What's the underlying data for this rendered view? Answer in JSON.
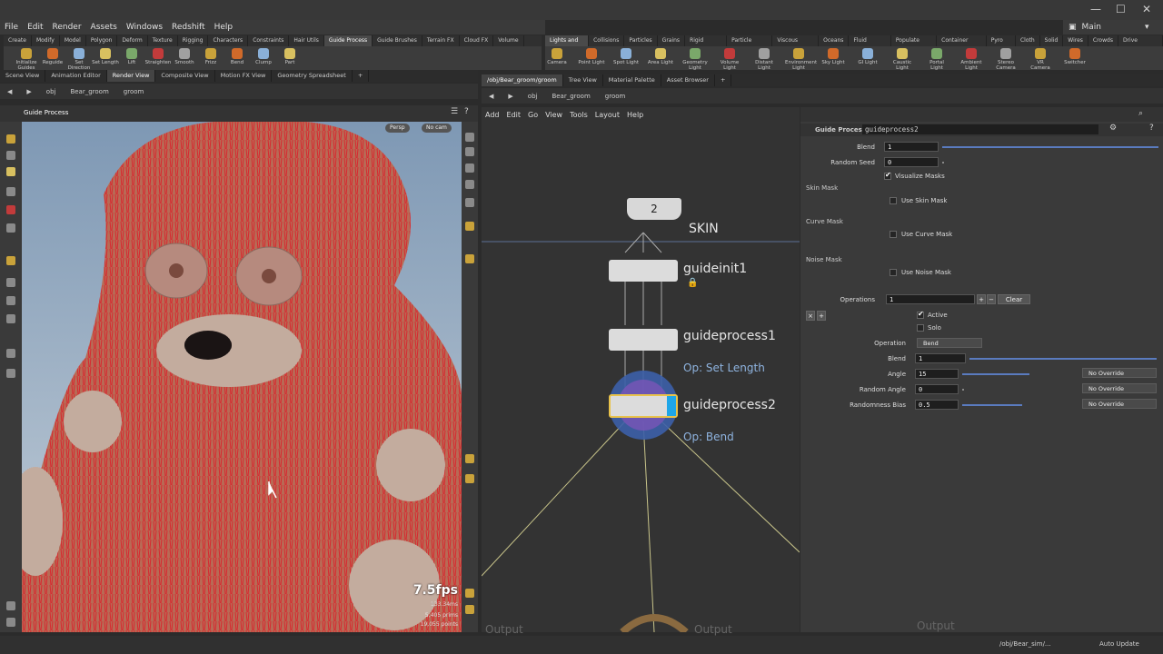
{
  "menu": [
    "File",
    "Edit",
    "Render",
    "Assets",
    "Windows",
    "Redshift",
    "Help"
  ],
  "desktop": "Main",
  "shelf_tabs_left": [
    "Create",
    "Modify",
    "Model",
    "Polygon",
    "Deform",
    "Texture",
    "Rigging",
    "Characters",
    "Constraints",
    "Hair Utils",
    "Guide Process",
    "Guide Brushes",
    "Terrain FX",
    "Cloud FX",
    "Volume"
  ],
  "shelf_tabs_right": [
    "Lights and C.",
    "Collisions",
    "Particles",
    "Grains",
    "Rigid Bodies",
    "Particle Fluids",
    "Viscous Fluids",
    "Oceans",
    "Fluid Contai.",
    "Populate Con.",
    "Container Tools",
    "Pyro FX",
    "Cloth",
    "Solid",
    "Wires",
    "Crowds",
    "Drive Simula."
  ],
  "tools_left": [
    "Initialize Guides",
    "Reguide",
    "Set Direction",
    "Set Length",
    "Lift",
    "Straighten",
    "Smooth",
    "Frizz",
    "Bend",
    "Clump",
    "Part"
  ],
  "tools_right": [
    "Camera",
    "Point Light",
    "Spot Light",
    "Area Light",
    "Geometry Light",
    "Volume Light",
    "Distant Light",
    "Environment Light",
    "Sky Light",
    "GI Light",
    "Caustic Light",
    "Portal Light",
    "Ambient Light",
    "Stereo Camera",
    "VR Camera",
    "Switcher"
  ],
  "left_tabs": [
    "Scene View",
    "Animation Editor",
    "Render View",
    "Composite View",
    "Motion FX View",
    "Geometry Spreadsheet"
  ],
  "right_tabs": [
    "/obj/Bear_groom/groom",
    "Tree View",
    "Material Palette",
    "Asset Browser"
  ],
  "path": {
    "obj": "obj",
    "object": "Bear_groom",
    "sop": "groom"
  },
  "viewport": {
    "title": "Guide Process",
    "persp": "Persp",
    "cam": "No cam",
    "fps": "7.5fps",
    "ms": "133.34ms",
    "prims": "5,405  prims",
    "points": "19,055 points"
  },
  "net_menu": [
    "Add",
    "Edit",
    "Go",
    "View",
    "Tools",
    "Layout",
    "Help"
  ],
  "nodes": {
    "merge_count": "2",
    "skin": "SKIN",
    "n1": "guideinit1",
    "n2": "guideprocess1",
    "n2_op": "Op: Set Length",
    "n3": "guideprocess2",
    "n3_op": "Op: Bend",
    "out1": "Output",
    "out2": "Output",
    "out3": "Output"
  },
  "params": {
    "type": "Guide Process",
    "name": "guideprocess2",
    "blend_label": "Blend",
    "blend": "1",
    "seed_label": "Random Seed",
    "seed": "0",
    "visualize": "Visualize Masks",
    "skin_mask": "Skin Mask",
    "use_skin": "Use Skin Mask",
    "curve_mask": "Curve Mask",
    "use_curve": "Use Curve Mask",
    "noise_mask": "Noise Mask",
    "use_noise": "Use Noise Mask",
    "ops_label": "Operations",
    "ops": "1",
    "clear": "Clear",
    "active": "Active",
    "solo": "Solo",
    "op_label": "Operation",
    "op": "Bend",
    "b2_label": "Blend",
    "b2": "1",
    "angle_label": "Angle",
    "angle": "15",
    "rangle_label": "Random Angle",
    "rangle": "0",
    "bias_label": "Randomness Bias",
    "bias": "0.5",
    "override": "No Override"
  },
  "status": {
    "path": "/obj/Bear_sim/...",
    "update": "Auto Update"
  }
}
